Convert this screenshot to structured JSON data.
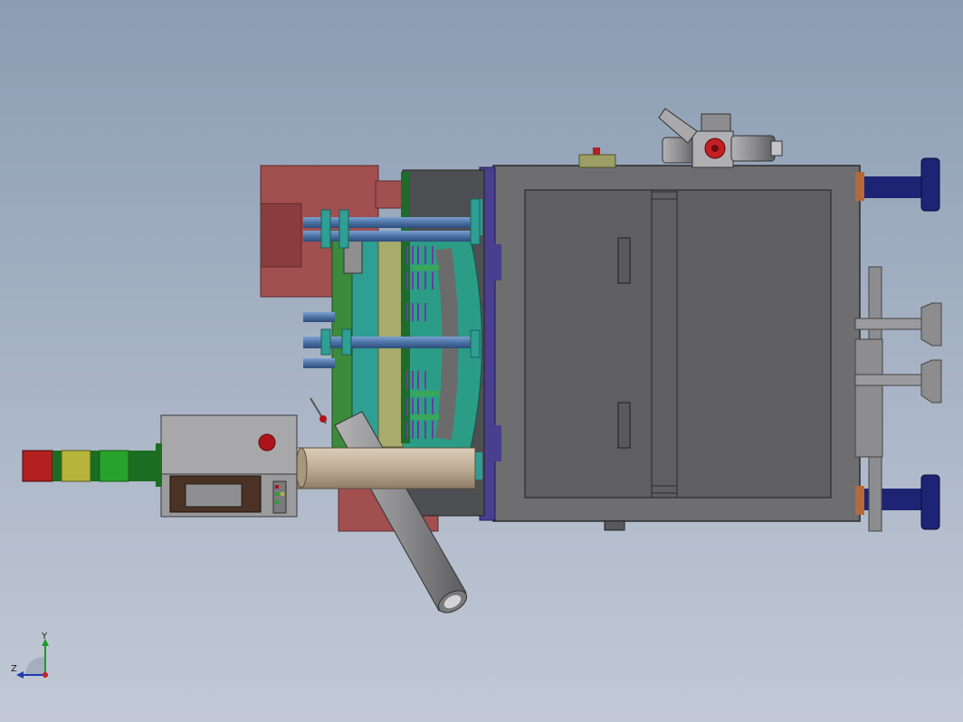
{
  "view": {
    "background_top": "#8b9db3",
    "background_bottom": "#c2c9d6"
  },
  "colors": {
    "mold_base": "#6e6e70",
    "mold_plate": "#5a5a5c",
    "purple_plate": "#4a3f8f",
    "red_block": "#a24f50",
    "blue_rod": "#4c72a6",
    "teal": "#2f9e93",
    "olive": "#9c9f63",
    "navy_cylinder": "#1e2474",
    "gray_cylinder": "#8d8d90",
    "tan_pipe": "#bfae96",
    "beacon_red": "#b22020",
    "beacon_yellow": "#b6b43a",
    "beacon_green": "#27a32b",
    "beacon_dark_green": "#1b6d22",
    "control_box": "#9b9b9d",
    "screen": "#8f8f91",
    "screen_frame": "#4a3224",
    "alarm_button": "#b0141b"
  },
  "triad": {
    "x_axis_label": "",
    "y_axis_label": "Y",
    "z_axis_label": "Z"
  }
}
